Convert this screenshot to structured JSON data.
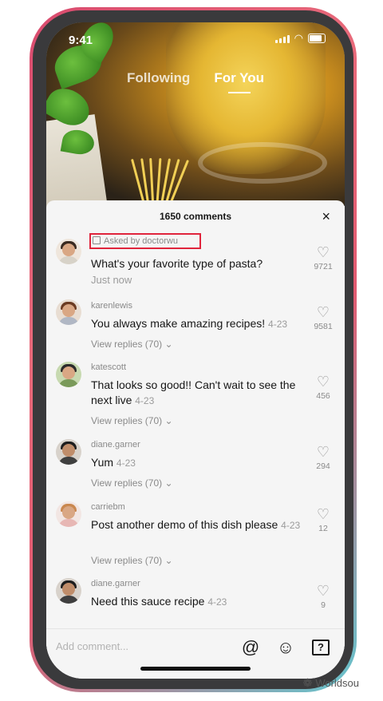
{
  "status_bar": {
    "time": "9:41"
  },
  "feed_tabs": [
    {
      "label": "Following"
    },
    {
      "label": "For You"
    }
  ],
  "comments_panel": {
    "title": "1650 comments",
    "close_label": "×",
    "asked_label": "Asked by doctorwu",
    "comments": [
      {
        "username": "",
        "text": "What's your favorite type of pasta?",
        "timestamp": "Just now",
        "likes": "9721"
      },
      {
        "username": "karenlewis",
        "text": "You always make amazing recipes!",
        "timestamp": "4-23",
        "replies": "View replies (70)",
        "likes": "9581"
      },
      {
        "username": "katescott",
        "text": "That looks so good!! Can't wait to see the next live",
        "timestamp": "4-23",
        "replies": "View replies (70)",
        "likes": "456"
      },
      {
        "username": "diane.garner",
        "text": "Yum",
        "timestamp": "4-23",
        "replies": "View replies (70)",
        "likes": "294"
      },
      {
        "username": "carriebm",
        "text": "Post another demo of this dish please",
        "timestamp": "4-23",
        "replies": "View replies (70)",
        "likes": "12"
      },
      {
        "username": "diane.garner",
        "text": "Need this sauce recipe",
        "timestamp": "4-23",
        "likes": "9"
      }
    ]
  },
  "comment_bar": {
    "placeholder": "Add comment...",
    "icons": [
      "at-sign-icon",
      "emoji-icon",
      "question-icon"
    ]
  },
  "watermark": {
    "text": "Worldsou"
  }
}
